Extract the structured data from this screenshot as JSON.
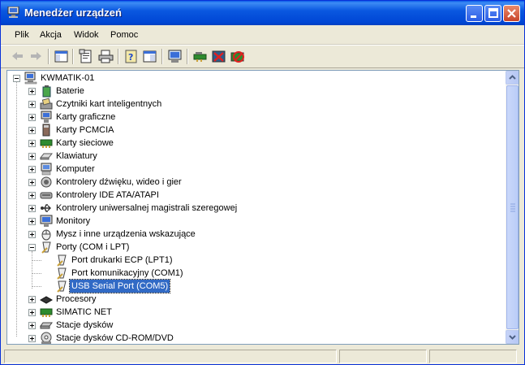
{
  "window": {
    "title": "Menedżer urządzeń"
  },
  "menu": [
    "Plik",
    "Akcja",
    "Widok",
    "Pomoc"
  ],
  "toolbar": [
    "back-icon",
    "forward-icon",
    "console-tree-icon",
    "properties-icon",
    "print-icon",
    "help-icon",
    "show-hide-icon",
    "update-driver-icon",
    "scan-hardware-icon",
    "disable-device-icon",
    "uninstall-device-icon"
  ],
  "tree": {
    "root": "KWMATIK-01",
    "categories": [
      {
        "label": "Baterie",
        "icon": "battery-icon"
      },
      {
        "label": "Czytniki kart inteligentnych",
        "icon": "smartcard-reader-icon"
      },
      {
        "label": "Karty graficzne",
        "icon": "display-adapter-icon"
      },
      {
        "label": "Karty PCMCIA",
        "icon": "pcmcia-icon"
      },
      {
        "label": "Karty sieciowe",
        "icon": "network-card-icon"
      },
      {
        "label": "Klawiatury",
        "icon": "keyboard-icon"
      },
      {
        "label": "Komputer",
        "icon": "computer-icon"
      },
      {
        "label": "Kontrolery dźwięku, wideo i gier",
        "icon": "sound-icon"
      },
      {
        "label": "Kontrolery IDE ATA/ATAPI",
        "icon": "ide-controller-icon"
      },
      {
        "label": "Kontrolery uniwersalnej magistrali szeregowej",
        "icon": "usb-icon"
      },
      {
        "label": "Monitory",
        "icon": "monitor-icon"
      },
      {
        "label": "Mysz i inne urządzenia wskazujące",
        "icon": "mouse-icon"
      },
      {
        "label": "Porty (COM i LPT)",
        "icon": "port-icon",
        "expanded": true,
        "children": [
          {
            "label": "Port drukarki ECP (LPT1)",
            "icon": "port-icon"
          },
          {
            "label": "Port komunikacyjny (COM1)",
            "icon": "port-icon"
          },
          {
            "label": "USB Serial Port (COM5)",
            "icon": "port-icon",
            "selected": true
          }
        ]
      },
      {
        "label": "Procesory",
        "icon": "processor-icon"
      },
      {
        "label": "SIMATIC NET",
        "icon": "network-card-icon"
      },
      {
        "label": "Stacje dysków",
        "icon": "disk-drive-icon"
      },
      {
        "label": "Stacje dysków CD-ROM/DVD",
        "icon": "cdrom-icon"
      }
    ]
  },
  "colors": {
    "titlebar": "#0a58e0",
    "selection": "#316ac5",
    "window_bg": "#ece9d8"
  }
}
